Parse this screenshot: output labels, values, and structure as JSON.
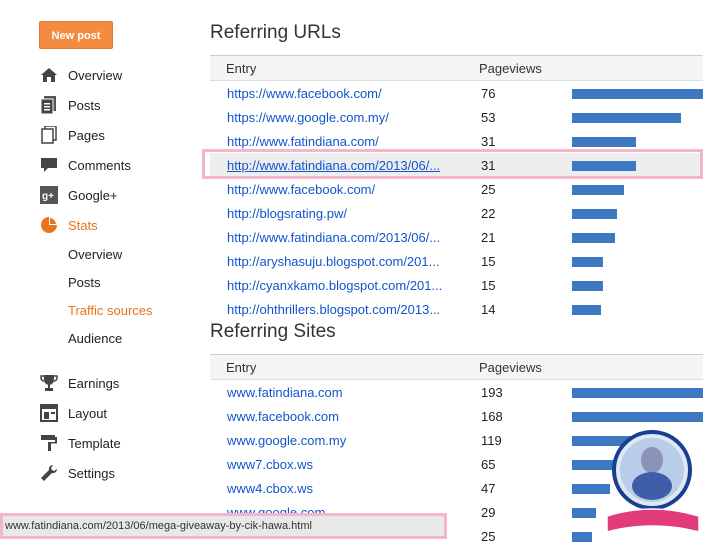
{
  "sidebar": {
    "new_post": "New post",
    "items": [
      {
        "label": "Overview",
        "icon": "home-icon"
      },
      {
        "label": "Posts",
        "icon": "posts-icon"
      },
      {
        "label": "Pages",
        "icon": "pages-icon"
      },
      {
        "label": "Comments",
        "icon": "comments-icon"
      },
      {
        "label": "Google+",
        "icon": "googleplus-icon"
      },
      {
        "label": "Stats",
        "icon": "stats-pie-icon"
      }
    ],
    "stats_sub": [
      "Overview",
      "Posts",
      "Traffic sources",
      "Audience"
    ],
    "items2": [
      {
        "label": "Earnings",
        "icon": "trophy-icon"
      },
      {
        "label": "Layout",
        "icon": "layout-icon"
      },
      {
        "label": "Template",
        "icon": "template-icon"
      },
      {
        "label": "Settings",
        "icon": "wrench-icon"
      }
    ]
  },
  "urls": {
    "title": "Referring URLs",
    "col_entry": "Entry",
    "col_views": "Pageviews",
    "rows": [
      {
        "entry": "https://www.facebook.com/",
        "views": "76"
      },
      {
        "entry": "https://www.google.com.my/",
        "views": "53"
      },
      {
        "entry": "http://www.fatindiana.com/",
        "views": "31"
      },
      {
        "entry": "http://www.fatindiana.com/2013/06/...",
        "views": "31"
      },
      {
        "entry": "http://www.facebook.com/",
        "views": "25"
      },
      {
        "entry": "http://blogsrating.pw/",
        "views": "22"
      },
      {
        "entry": "http://www.fatindiana.com/2013/06/...",
        "views": "21"
      },
      {
        "entry": "http://aryshasuju.blogspot.com/201...",
        "views": "15"
      },
      {
        "entry": "http://cyanxkamo.blogspot.com/201...",
        "views": "15"
      },
      {
        "entry": "http://ohthrillers.blogspot.com/2013...",
        "views": "14"
      }
    ]
  },
  "sites": {
    "title": "Referring Sites",
    "col_entry": "Entry",
    "col_views": "Pageviews",
    "rows": [
      {
        "entry": "www.fatindiana.com",
        "views": "193"
      },
      {
        "entry": "www.facebook.com",
        "views": "168"
      },
      {
        "entry": "www.google.com.my",
        "views": "119"
      },
      {
        "entry": "www7.cbox.ws",
        "views": "65"
      },
      {
        "entry": "www4.cbox.ws",
        "views": "47"
      },
      {
        "entry": "www.google.com",
        "views": "29"
      },
      {
        "entry": "",
        "views": "25"
      }
    ]
  },
  "status_url": "www.fatindiana.com/2013/06/mega-giveaway-by-cik-hawa.html",
  "colors": {
    "accent": "#e8731d",
    "link": "#1155cc",
    "bar": "#3d78c0",
    "highlight_frame": "#f4b6cb"
  }
}
